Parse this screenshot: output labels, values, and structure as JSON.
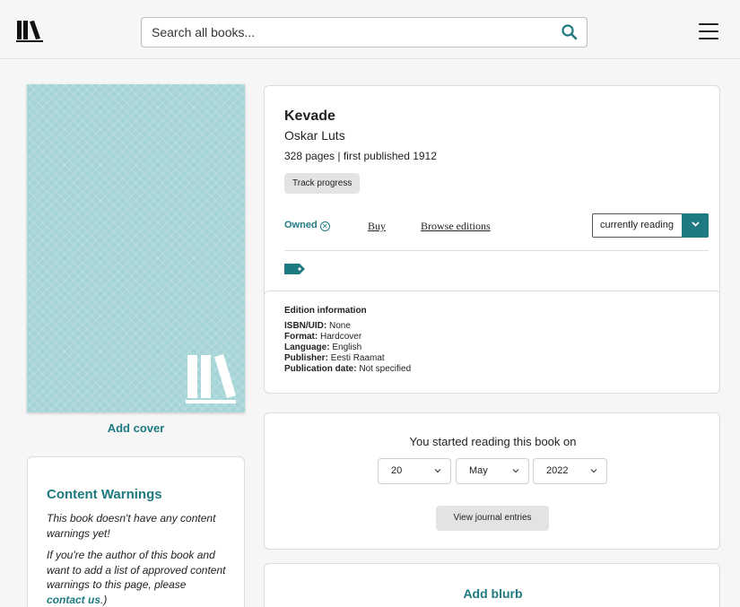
{
  "header": {
    "search_placeholder": "Search all books...",
    "logo_icon": "bookshelf-logo-icon",
    "search_icon": "search-icon",
    "menu_icon": "hamburger-menu-icon"
  },
  "cover": {
    "add_cover_label": "Add cover",
    "placeholder_color": "#a5d4d6"
  },
  "content_warnings": {
    "title": "Content Warnings",
    "empty_text": "This book doesn't have any content warnings yet!",
    "author_text": "If you're the author of this book and want to add a list of approved content warnings to this page, please",
    "contact_link": "contact us",
    "suffix": ".)"
  },
  "book": {
    "title": "Kevade",
    "author": "Oskar Luts",
    "meta": "328 pages | first published 1912",
    "track_progress_label": "Track progress",
    "owned_label": "Owned",
    "buy_label": "Buy",
    "browse_editions_label": "Browse editions",
    "status_value": "currently reading",
    "tag_icon": "tag-icon"
  },
  "edition": {
    "heading": "Edition information",
    "isbn_label": "ISBN/UID:",
    "isbn_value": "None",
    "format_label": "Format:",
    "format_value": "Hardcover",
    "language_label": "Language:",
    "language_value": "English",
    "publisher_label": "Publisher:",
    "publisher_value": "Eesti Raamat",
    "pubdate_label": "Publication date:",
    "pubdate_value": "Not specified"
  },
  "reading": {
    "label": "You started reading this book on",
    "day": "20",
    "month": "May",
    "year": "2022",
    "journal_button": "View journal entries"
  },
  "blurb": {
    "add_blurb_label": "Add blurb"
  },
  "colors": {
    "accent": "#1e7a80",
    "background": "#f6f6f6"
  }
}
